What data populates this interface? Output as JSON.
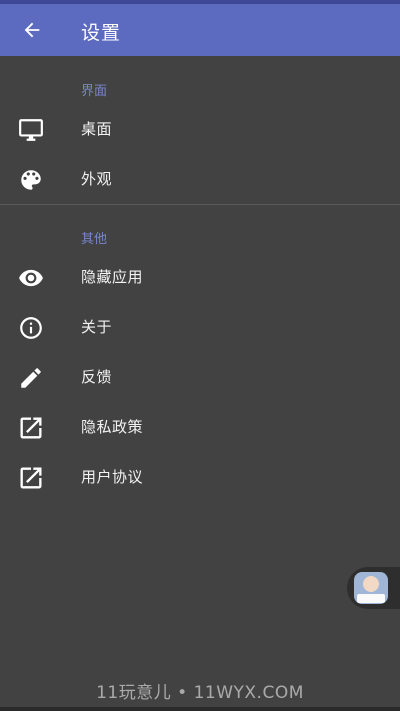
{
  "appbar": {
    "title": "设置",
    "back_icon": "arrow-back-icon",
    "color": "#5c6bc0"
  },
  "sections": [
    {
      "header": "界面",
      "items": [
        {
          "label": "桌面",
          "icon": "monitor-icon"
        },
        {
          "label": "外观",
          "icon": "palette-icon"
        }
      ]
    },
    {
      "header": "其他",
      "items": [
        {
          "label": "隐藏应用",
          "icon": "eye-icon"
        },
        {
          "label": "关于",
          "icon": "info-icon"
        },
        {
          "label": "反馈",
          "icon": "pencil-icon"
        },
        {
          "label": "隐私政策",
          "icon": "open-in-new-icon"
        },
        {
          "label": "用户协议",
          "icon": "open-in-new-icon"
        }
      ]
    }
  ],
  "colors": {
    "background": "#424242",
    "accent": "#7986cb",
    "text": "#f2f2f2"
  },
  "watermark": "11玩意儿 • 11WYX.COM"
}
